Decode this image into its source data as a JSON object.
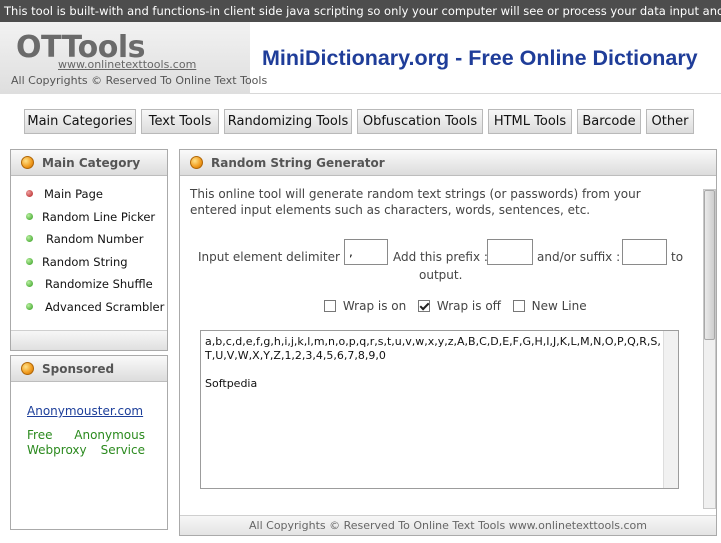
{
  "notice": "This tool is built-with and functions-in client side java scripting so only your computer will see or process your data input and output.",
  "header": {
    "logo": "OTTools",
    "logo_url": "www.onlinetexttools.com",
    "copyright": "All Copyrights © Reserved To Online Text Tools",
    "site_title": "MiniDictionary.org - Free Online Dictionary"
  },
  "nav": [
    {
      "label": "Main Categories"
    },
    {
      "label": "Text Tools"
    },
    {
      "label": "Randomizing Tools"
    },
    {
      "label": "Obfuscation Tools"
    },
    {
      "label": "HTML Tools"
    },
    {
      "label": "Barcode"
    },
    {
      "label": "Other"
    }
  ],
  "sidebar": {
    "title": "Main Category",
    "items": [
      {
        "label": "Main Page"
      },
      {
        "label": "Random Line Picker"
      },
      {
        "label": "Random Number"
      },
      {
        "label": "Random String"
      },
      {
        "label": "Randomize Shuffle"
      },
      {
        "label": "Advanced Scrambler"
      }
    ]
  },
  "sponsored": {
    "title": "Sponsored",
    "link": "Anonymouster.com",
    "text": "Free Anonymous Webproxy Service"
  },
  "main": {
    "title": "Random String Generator",
    "description": "This online tool will generate random text strings (or passwords) from your entered input elements such as characters, words, sentences, etc.",
    "delimiter_label": "Input element delimiter :",
    "delimiter_value": ",",
    "prefix_label": "Add this prefix :",
    "prefix_value": "",
    "suffix_label": "and/or suffix :",
    "suffix_value": "",
    "to_label": "to",
    "output_label": "output.",
    "options": [
      {
        "label": "Wrap is on",
        "checked": false
      },
      {
        "label": "Wrap is off",
        "checked": true
      },
      {
        "label": "New Line",
        "checked": false
      }
    ],
    "output_text": "a,b,c,d,e,f,g,h,i,j,k,l,m,n,o,p,q,r,s,t,u,v,w,x,y,z,A,B,C,D,E,F,G,H,I,J,K,L,M,N,O,P,Q,R,S,T,U,V,W,X,Y,Z,1,2,3,4,5,6,7,8,9,0\n\nSoftpedia",
    "footer": "All Copyrights © Reserved To Online Text Tools   www.onlinetexttools.com"
  },
  "colors": {
    "title_blue": "#1f3d99",
    "sponsor_green": "#2b8a1e",
    "notice_bg": "#4d4d4d"
  }
}
